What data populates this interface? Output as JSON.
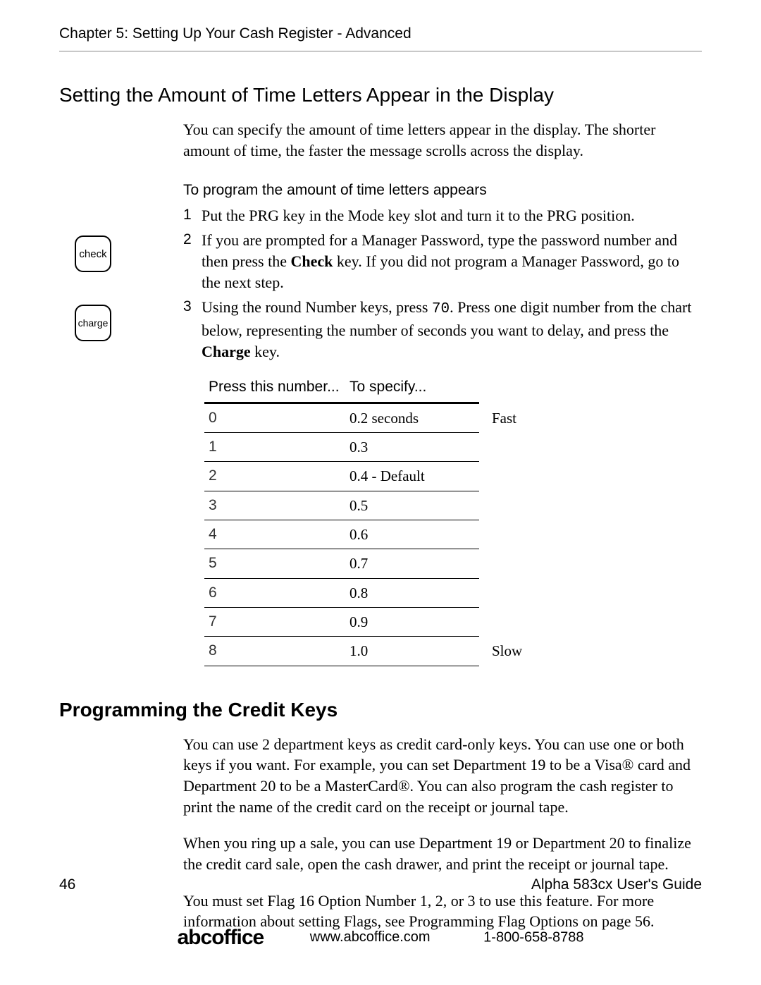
{
  "chapter_header": "Chapter 5:   Setting Up Your Cash Register - Advanced",
  "section1": {
    "title": "Setting the Amount of Time Letters Appear in the Display",
    "intro": "You can specify the amount of time letters appear in the display. The shorter amount of time, the faster the message scrolls across the display.",
    "task_title": "To program the amount of time letters appears",
    "steps": {
      "s1_num": "1",
      "s1_text": "Put the PRG key in the Mode key slot and turn it to the PRG position.",
      "s2_num": "2",
      "s2_a": "If you are prompted for a Manager Password, type the password number and then press the ",
      "s2_b": "Check",
      "s2_c": " key. If you did not program a Manager Password, go to the next step.",
      "s3_num": "3",
      "s3_a": "Using the round Number keys, press ",
      "s3_code": "70",
      "s3_b": ". Press one digit number from the chart below, representing the number of seconds you want to delay, and press the ",
      "s3_c": "Charge",
      "s3_d": " key."
    },
    "key_labels": {
      "check": "check",
      "charge": "charge"
    },
    "table": {
      "header_press": "Press this number...",
      "header_spec": "To specify...",
      "rows": [
        {
          "n": "0",
          "v": "0.2 seconds",
          "note": "Fast"
        },
        {
          "n": "1",
          "v": "0.3",
          "note": ""
        },
        {
          "n": "2",
          "v": "0.4 - Default",
          "note": ""
        },
        {
          "n": "3",
          "v": "0.5",
          "note": ""
        },
        {
          "n": "4",
          "v": "0.6",
          "note": ""
        },
        {
          "n": "5",
          "v": "0.7",
          "note": ""
        },
        {
          "n": "6",
          "v": "0.8",
          "note": ""
        },
        {
          "n": "7",
          "v": "0.9",
          "note": ""
        },
        {
          "n": "8",
          "v": "1.0",
          "note": "Slow"
        }
      ]
    }
  },
  "section2": {
    "title": "Programming the Credit Keys",
    "p1": "You can use 2 department keys as credit card-only keys. You can use one or both keys if you want. For example, you can set Department 19 to be a Visa® card and Department 20 to be a MasterCard®. You can also program the cash register to print the name of the credit card on the receipt or journal tape.",
    "p2": "When you ring up a sale, you can use Department 19 or Department 20 to finalize the credit card sale, open the cash drawer, and print the receipt or journal tape.",
    "p3": "You must set Flag 16 Option Number 1, 2, or 3 to use this feature. For more information about setting Flags, see Programming Flag Options on page 56."
  },
  "footer": {
    "page": "46",
    "guide": "Alpha 583cx  User's Guide",
    "brand": "abcoffice",
    "url": "www.abcoffice.com",
    "phone": "1-800-658-8788"
  }
}
